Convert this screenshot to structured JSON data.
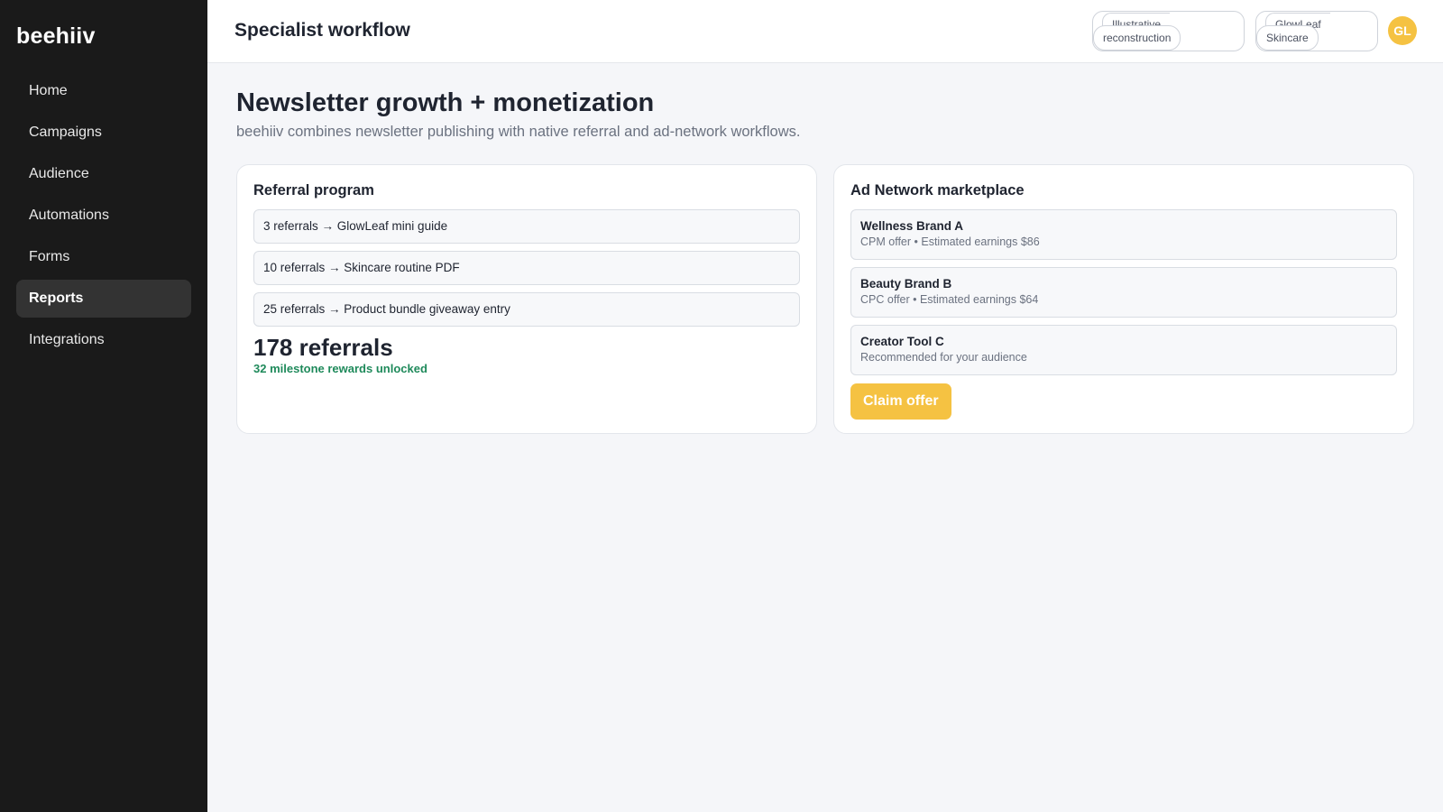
{
  "sidebar": {
    "brand": "beehiiv",
    "items": [
      {
        "label": "Home",
        "active": false
      },
      {
        "label": "Campaigns",
        "active": false
      },
      {
        "label": "Audience",
        "active": false
      },
      {
        "label": "Automations",
        "active": false
      },
      {
        "label": "Forms",
        "active": false
      },
      {
        "label": "Reports",
        "active": true
      },
      {
        "label": "Integrations",
        "active": false
      }
    ]
  },
  "header": {
    "title": "Specialist workflow",
    "chips": [
      {
        "line1": "Illustrative",
        "line2": "reconstruction"
      },
      {
        "line1": "GlowLeaf",
        "line2": "Skincare"
      }
    ],
    "avatar": "GL"
  },
  "main": {
    "title": "Newsletter growth + monetization",
    "subtitle": "beehiiv combines newsletter publishing with native referral and ad-network workflows."
  },
  "referral": {
    "title": "Referral program",
    "milestones": [
      "3 referrals → GlowLeaf mini guide",
      "10 referrals → Skincare routine PDF",
      "25 referrals → Product bundle giveaway entry"
    ],
    "count": "178 referrals",
    "note": "32 milestone rewards unlocked"
  },
  "ad_network": {
    "title": "Ad Network marketplace",
    "offers": [
      {
        "name": "Wellness Brand A",
        "detail": "CPM offer • Estimated earnings $86"
      },
      {
        "name": "Beauty Brand B",
        "detail": "CPC offer • Estimated earnings $64"
      },
      {
        "name": "Creator Tool C",
        "detail": "Recommended for your audience"
      }
    ],
    "claim_label": "Claim offer"
  },
  "colors": {
    "sidebar_bg": "#1a1a1a",
    "accent": "#f5c242",
    "success": "#1f8a5b"
  }
}
